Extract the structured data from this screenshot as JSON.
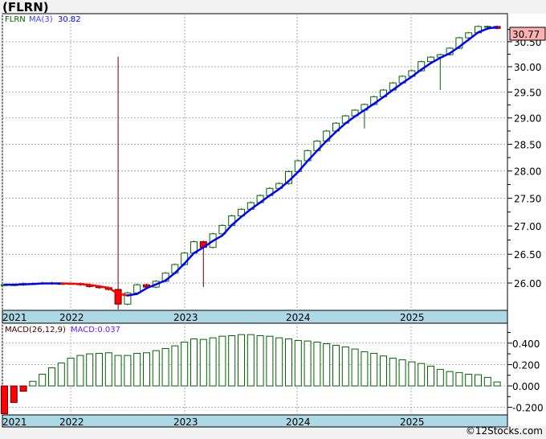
{
  "title": "(FLRN)",
  "footer": "©12Stocks.com",
  "chart_data": [
    {
      "type": "candlestick",
      "ticker_label": "FLRN",
      "ma_label": "MA(3)",
      "ma_value": "30.82",
      "last_price": "30.77",
      "scale": "log",
      "ylim": [
        25.55,
        31.0
      ],
      "y_ticks": [
        "26.00",
        "26.50",
        "27.00",
        "27.50",
        "28.00",
        "28.50",
        "29.00",
        "29.50",
        "30.00",
        "30.50"
      ],
      "x_ticks": [
        "2021",
        "2022",
        "2023",
        "2024",
        "2025"
      ],
      "first_period": "2021-06",
      "interval": "monthly",
      "closes": [
        25.97,
        25.97,
        25.99,
        25.99,
        26.0,
        25.99,
        25.99,
        25.99,
        25.97,
        25.94,
        25.92,
        25.89,
        25.64,
        25.83,
        25.97,
        25.93,
        26.03,
        26.17,
        26.32,
        26.52,
        26.72,
        26.62,
        26.86,
        27.01,
        27.18,
        27.3,
        27.42,
        27.55,
        27.68,
        27.77,
        27.99,
        28.19,
        28.38,
        28.56,
        28.75,
        28.9,
        29.04,
        29.15,
        29.26,
        29.41,
        29.54,
        29.68,
        29.81,
        29.92,
        30.1,
        30.19,
        30.24,
        30.37,
        30.58,
        30.68,
        30.81,
        30.81,
        30.77
      ],
      "long_wicks": [
        {
          "index": 12,
          "high": 30.2,
          "low": 25.55
        },
        {
          "index": 21,
          "low": 25.93
        },
        {
          "index": 38,
          "low": 28.8
        },
        {
          "index": 46,
          "low": 29.54
        }
      ],
      "colors": {
        "up": "#006400",
        "down": "#ff0000",
        "ma": "#0000ff",
        "ma_down": "#ff0000",
        "axis_strip": "#add8e6",
        "last_price_box": "#ffb0b0"
      },
      "grid": true
    },
    {
      "type": "bar",
      "label": "MACD(26,12,9)",
      "value_label": "MACD:0.037",
      "ylim": [
        -0.27,
        0.6
      ],
      "y_ticks": [
        "0.400",
        "0.200",
        "0.000",
        "-0.200"
      ],
      "values": [
        -0.26,
        -0.155,
        -0.05,
        0.043,
        0.11,
        0.17,
        0.215,
        0.26,
        0.285,
        0.3,
        0.305,
        0.31,
        0.285,
        0.285,
        0.305,
        0.31,
        0.33,
        0.35,
        0.375,
        0.41,
        0.44,
        0.435,
        0.45,
        0.465,
        0.47,
        0.48,
        0.48,
        0.47,
        0.465,
        0.45,
        0.44,
        0.425,
        0.42,
        0.41,
        0.395,
        0.38,
        0.365,
        0.345,
        0.32,
        0.305,
        0.28,
        0.26,
        0.245,
        0.225,
        0.21,
        0.185,
        0.155,
        0.135,
        0.125,
        0.11,
        0.105,
        0.08,
        0.037
      ],
      "colors": {
        "positive": "#006400",
        "negative": "#ff0000"
      }
    }
  ]
}
